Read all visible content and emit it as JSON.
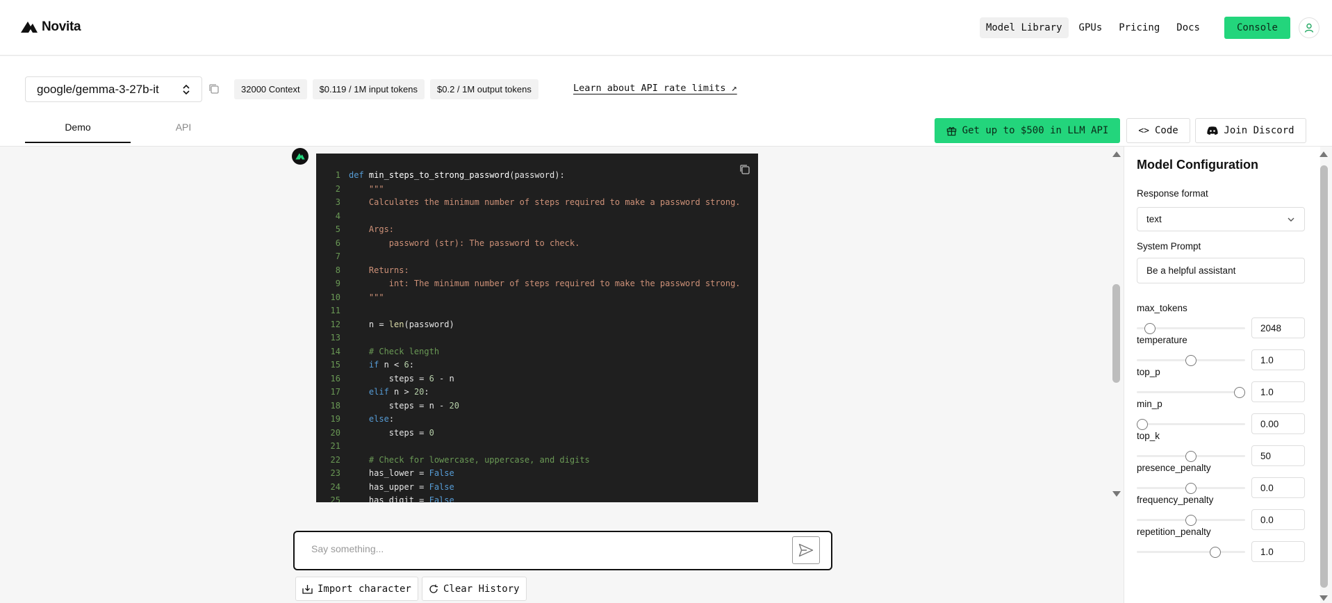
{
  "brand": {
    "name": "Novita"
  },
  "nav": {
    "links": [
      "Model Library",
      "GPUs",
      "Pricing",
      "Docs"
    ],
    "console_label": "Console"
  },
  "model": {
    "name": "google/gemma-3-27b-it",
    "chips": [
      "32000 Context",
      "$0.119 / 1M input tokens",
      "$0.2 / 1M output tokens"
    ],
    "rate_link": "Learn about API rate limits ↗"
  },
  "tabs": [
    "Demo",
    "API"
  ],
  "actions": {
    "promo": "Get up to $500 in LLM API",
    "code": "Code",
    "discord": "Join Discord"
  },
  "code": {
    "lines": [
      "def min_steps_to_strong_password(password):",
      "    \"\"\"",
      "    Calculates the minimum number of steps required to make a password strong.",
      "",
      "    Args:",
      "        password (str): The password to check.",
      "",
      "    Returns:",
      "        int: The minimum number of steps required to make the password strong.",
      "    \"\"\"",
      "",
      "    n = len(password)",
      "",
      "    # Check length",
      "    if n < 6:",
      "        steps = 6 - n",
      "    elif n > 20:",
      "        steps = n - 20",
      "    else:",
      "        steps = 0",
      "",
      "    # Check for lowercase, uppercase, and digits",
      "    has_lower = False",
      "    has_upper = False",
      "    has_digit = False"
    ]
  },
  "chat": {
    "placeholder": "Say something...",
    "import_label": "Import character",
    "clear_label": "Clear History"
  },
  "config": {
    "title": "Model Configuration",
    "response_format_label": "Response format",
    "response_format_value": "text",
    "system_prompt_label": "System Prompt",
    "system_prompt_value": "Be a helpful assistant",
    "params": [
      {
        "name": "max_tokens",
        "value": "2048",
        "level": 0.08
      },
      {
        "name": "temperature",
        "value": "1.0",
        "level": 0.5
      },
      {
        "name": "top_p",
        "value": "1.0",
        "level": 1.0
      },
      {
        "name": "min_p",
        "value": "0.00",
        "level": 0.0
      },
      {
        "name": "top_k",
        "value": "50",
        "level": 0.5
      },
      {
        "name": "presence_penalty",
        "value": "0.0",
        "level": 0.5
      },
      {
        "name": "frequency_penalty",
        "value": "0.0",
        "level": 0.5
      },
      {
        "name": "repetition_penalty",
        "value": "1.0",
        "level": 0.75
      }
    ]
  },
  "colors": {
    "accent": "#23d57c",
    "code_bg": "#1f1f1f"
  }
}
